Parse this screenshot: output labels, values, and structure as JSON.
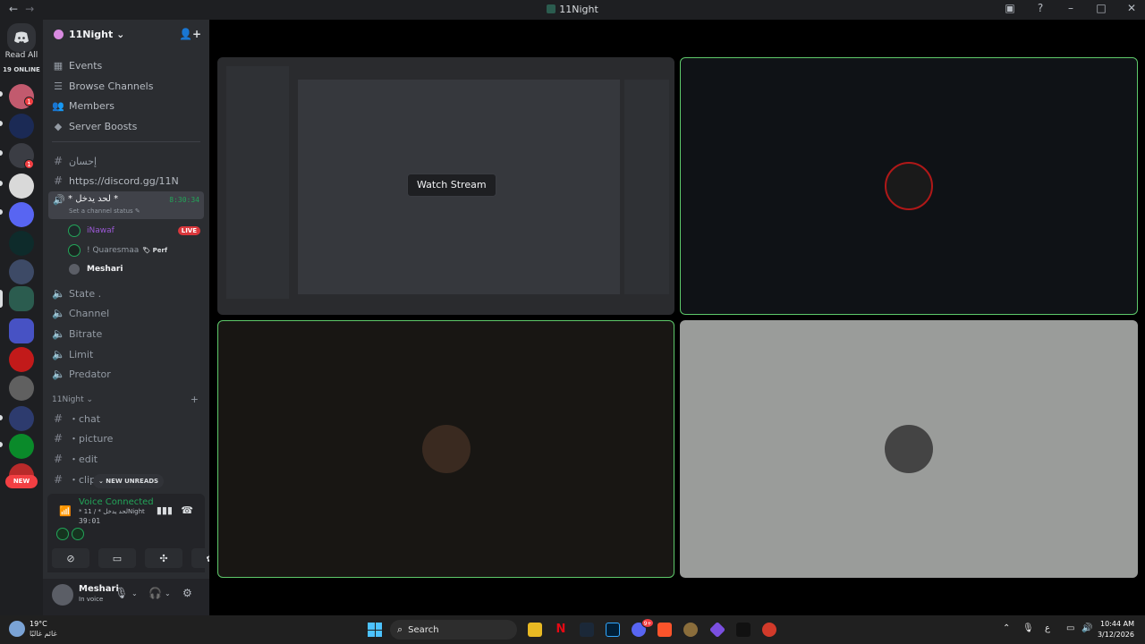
{
  "window": {
    "title": "11Night"
  },
  "guild_bar": {
    "read_all": "Read All",
    "online": "19 ONLINE",
    "new_label": "NEW"
  },
  "server": {
    "name": "11Night ⌄"
  },
  "nav": [
    {
      "label": "Events",
      "icon": "calendar-icon"
    },
    {
      "label": "Browse Channels",
      "icon": "browse-icon"
    },
    {
      "label": "Members",
      "icon": "members-icon"
    },
    {
      "label": "Server Boosts",
      "icon": "boost-icon"
    }
  ],
  "channels_top": [
    {
      "label": "إحسان",
      "icon": "hashtag-icon"
    },
    {
      "label": "https://discord.gg/11N",
      "icon": "hashtag-icon"
    }
  ],
  "active_voice": {
    "name": "* لحد يدخل *",
    "timer": "8:30:34",
    "status": "Set a channel status ✎"
  },
  "voice_users": [
    {
      "name": "iNawaf",
      "color": "#9b59d6",
      "live": "LIVE"
    },
    {
      "name": "! Quaresmaa",
      "tag": "🏷 Perf",
      "color": "#b5bac1"
    },
    {
      "name": "Meshari",
      "color": "#f2f3f5"
    }
  ],
  "voice_channels": [
    "State .",
    "Channel",
    "Bitrate",
    "Limit",
    "Predator"
  ],
  "category": {
    "name": "11Night ⌄"
  },
  "text_channels": [
    "・chat",
    "・picture",
    "・edit",
    "・clip"
  ],
  "new_unreads": "⌄ NEW UNREADS",
  "voice_panel": {
    "title": "Voice Connected",
    "subtitle": "* لحد يدخل * / 11Night",
    "time": "39:01"
  },
  "user": {
    "name": "Meshari",
    "status": "In voice"
  },
  "stage": {
    "watch_label": "Watch Stream"
  },
  "taskbar": {
    "weather_temp": "19°C",
    "weather_desc": "غائم غالبًا",
    "search": "Search",
    "discord_badge": "9+",
    "lang": "ع",
    "time": "10:44 AM",
    "date": "3/12/2026"
  },
  "colors": {
    "speaking": "#5ec96a",
    "accent": "#23a559",
    "live": "#da373c"
  }
}
